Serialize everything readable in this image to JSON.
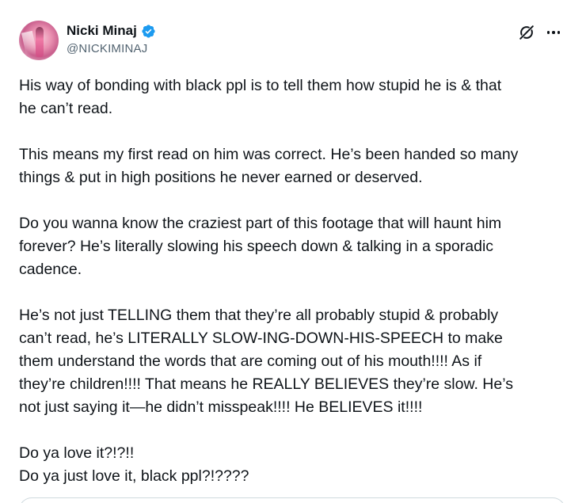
{
  "author": {
    "name": "Nicki Minaj",
    "handle": "@NICKIMINAJ",
    "verified_badge_color": "#1d9bf0",
    "avatar_icon": "profile-photo"
  },
  "actions": {
    "grok_icon": "grok-icon",
    "more_icon": "more-options-icon"
  },
  "tweet": {
    "paragraphs": [
      "His way of bonding with black ppl is to tell them how stupid he is & that\nhe can’t read.",
      "This means my first read on him was correct. He’s been handed so many\nthings & put in high positions he never earned or deserved.",
      "Do you wanna know the craziest part of this footage that will haunt him\nforever? He’s literally slowing his speech down & talking in a sporadic\ncadence.",
      "He’s not just TELLING them that they’re all probably stupid & probably\ncan’t read, he’s LITERALLY SLOW-ING-DOWN-HIS-SPEECH to make\nthem understand the words that are coming out of his mouth!!!! As if\nthey’re children!!!! That means he REALLY BELIEVES they’re slow. He’s\nnot just saying it—he didn’t misspeak!!!! He BELIEVES it!!!!",
      "Do ya love it?!?!!\nDo ya just love it, black ppl?!????"
    ]
  }
}
